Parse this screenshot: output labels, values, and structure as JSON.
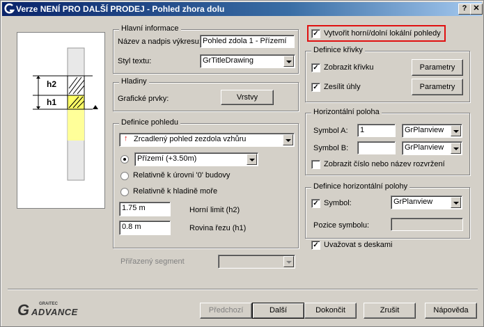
{
  "window": {
    "title": "Verze NENÍ PRO DALŠÍ PRODEJ - Pohled zhora dolu",
    "help_glyph": "?",
    "close_glyph": "✕"
  },
  "preview": {
    "h2": "h2",
    "h1": "h1"
  },
  "main_info": {
    "caption": "Hlavní informace",
    "name_label": "Název a nadpis výkresu:",
    "name_value": "Pohled zdola 1 - Přízemí",
    "text_style_label": "Styl textu:",
    "text_style_value": "GrTitleDrawing"
  },
  "layers": {
    "caption": "Hladiny",
    "graphic_label": "Grafické prvky:",
    "layers_button": "Vrstvy"
  },
  "view_def": {
    "caption": "Definice pohledu",
    "view_type": "Zrcadlený pohled zezdola vzhůru",
    "level_value": "Přízemí (+3.50m)",
    "radio_relative_zero": "Relativně k úrovni '0' budovy",
    "radio_sea_level": "Relativně k hladině moře",
    "upper_limit_value": "1.75 m",
    "upper_limit_label": "Horní limit (h2)",
    "cut_plane_value": "0.8 m",
    "cut_plane_label": "Rovina řezu (h1)"
  },
  "segment": {
    "label": "Přiřazený segment",
    "value": ""
  },
  "local_views": {
    "label": "Vytvořit horní/dolní lokální pohledy",
    "checked": true
  },
  "curve_def": {
    "caption": "Definice křivky",
    "show_curve": "Zobrazit křivku",
    "thicken_angles": "Zesílit úhly",
    "params1": "Parametry",
    "params2": "Parametry"
  },
  "hpos": {
    "caption": "Horizontální poloha",
    "symbol_a_label": "Symbol A:",
    "symbol_a_value": "1",
    "symbol_a_style": "GrPlanview",
    "symbol_b_label": "Symbol B:",
    "symbol_b_value": "",
    "symbol_b_style": "GrPlanview",
    "show_name": "Zobrazit číslo nebo název rozvržení"
  },
  "hpos_def": {
    "caption": "Definice horizontální polohy",
    "symbol_label": "Symbol:",
    "symbol_style": "GrPlanview",
    "symbol_pos_label": "Pozice symbolu:",
    "symbol_pos_value": ""
  },
  "slabs": {
    "label": "Uvažovat s deskami"
  },
  "brand": {
    "top": "GRAITEC",
    "name": "ADVANCE"
  },
  "buttons": {
    "prev": "Předchozí",
    "next": "Další",
    "finish": "Dokončit",
    "cancel": "Zrušit",
    "help": "Nápověda"
  },
  "colors": {
    "accent_red": "#e01010",
    "title_blue": "#0a246a",
    "level_yellow": "#ffff66"
  }
}
